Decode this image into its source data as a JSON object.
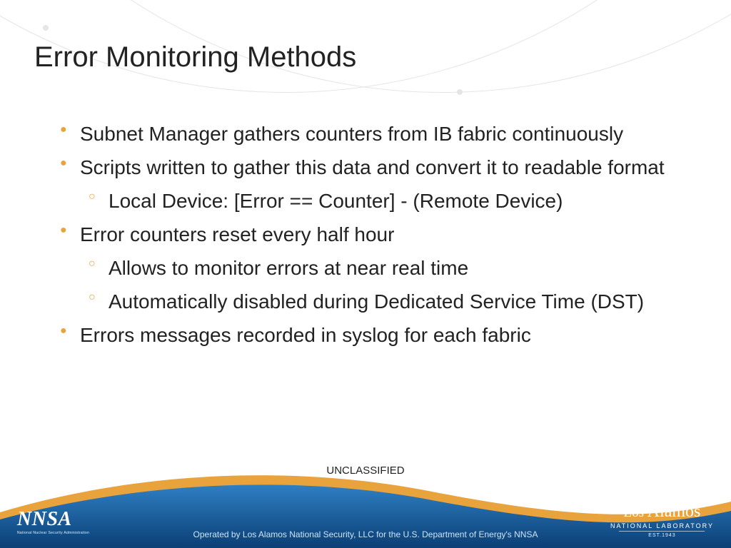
{
  "title": "Error Monitoring Methods",
  "bullets": {
    "b0": "Subnet Manager gathers counters from IB fabric continuously",
    "b1": "Scripts written to gather this data and convert it to readable format",
    "b1_0": "Local Device: [Error == Counter] - (Remote Device)",
    "b2": "Error counters reset every half hour",
    "b2_0": "Allows to monitor errors at near real time",
    "b2_1": "Automatically disabled during Dedicated Service Time (DST)",
    "b3": "Errors messages recorded in syslog for each fabric"
  },
  "classification": "UNCLASSIFIED",
  "footer": {
    "operated": "Operated by Los Alamos National Security, LLC for the U.S. Department of Energy's NNSA"
  },
  "logos": {
    "nnsa": "NNSA",
    "nnsa_sub": "National Nuclear Security Administration",
    "la_los": "Los",
    "la_alamos": "Alamos",
    "la_natlab": "NATIONAL LABORATORY",
    "la_est": "EST.1943"
  },
  "colors": {
    "accent_orange": "#e8a33d",
    "footer_blue_dark": "#0b3f75",
    "footer_blue_light": "#2f7fc3"
  }
}
